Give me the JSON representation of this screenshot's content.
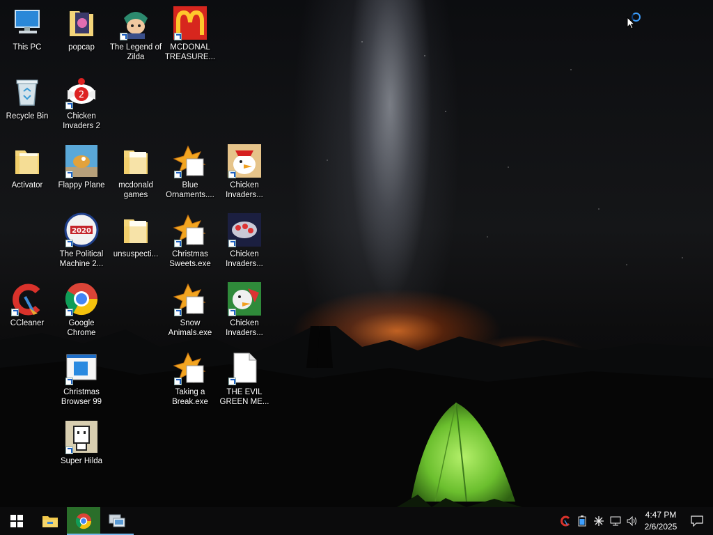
{
  "desktop": {
    "icons": [
      {
        "name": "this-pc-icon",
        "label": "This PC"
      },
      {
        "name": "popcap-folder-icon",
        "label": "popcap"
      },
      {
        "name": "legend-of-zilda-icon",
        "label": "The Legend of Zilda"
      },
      {
        "name": "mcdonald-treasure-icon",
        "label": "MCDONAL TREASURE..."
      },
      {
        "name": "recycle-bin-icon",
        "label": "Recycle Bin"
      },
      {
        "name": "chicken-invaders-2-icon",
        "label": "Chicken Invaders 2"
      },
      {
        "name": "activator-folder-icon",
        "label": "Activator"
      },
      {
        "name": "flappy-plane-icon",
        "label": "Flappy Plane"
      },
      {
        "name": "mcdonald-games-folder-icon",
        "label": "mcdonald games"
      },
      {
        "name": "blue-ornaments-icon",
        "label": "Blue Ornaments...."
      },
      {
        "name": "chicken-invaders-a-icon",
        "label": "Chicken Invaders..."
      },
      {
        "name": "political-machine-icon",
        "label": "The Political Machine 2..."
      },
      {
        "name": "unsuspecting-folder-icon",
        "label": "unsuspecti..."
      },
      {
        "name": "christmas-sweets-icon",
        "label": "Christmas Sweets.exe"
      },
      {
        "name": "chicken-invaders-b-icon",
        "label": "Chicken Invaders..."
      },
      {
        "name": "ccleaner-icon",
        "label": "CCleaner"
      },
      {
        "name": "google-chrome-icon",
        "label": "Google Chrome"
      },
      {
        "name": "snow-animals-icon",
        "label": "Snow Animals.exe"
      },
      {
        "name": "chicken-invaders-c-icon",
        "label": "Chicken Invaders..."
      },
      {
        "name": "christmas-browser-icon",
        "label": "Christmas Browser 99"
      },
      {
        "name": "taking-a-break-icon",
        "label": "Taking a Break.exe"
      },
      {
        "name": "evil-green-icon",
        "label": "THE EVIL GREEN ME..."
      },
      {
        "name": "super-hilda-icon",
        "label": "Super Hilda"
      }
    ]
  },
  "taskbar": {
    "start": "windows-start-icon",
    "pinned": [
      "file-explorer-icon",
      "chrome-icon",
      "remote-desktop-icon"
    ],
    "tray": [
      "ccleaner-tray-icon",
      "battery-icon",
      "bluetooth-icon",
      "network-icon",
      "volume-icon"
    ],
    "time": "4:47 PM",
    "date": "2/6/2025",
    "notification": "action-center-icon"
  },
  "colors": {
    "taskbar_bg": "#0b0b0c",
    "accent": "#76b9ed",
    "tent_green": "#7fd14a",
    "horizon_glow": "#e06a1e"
  }
}
